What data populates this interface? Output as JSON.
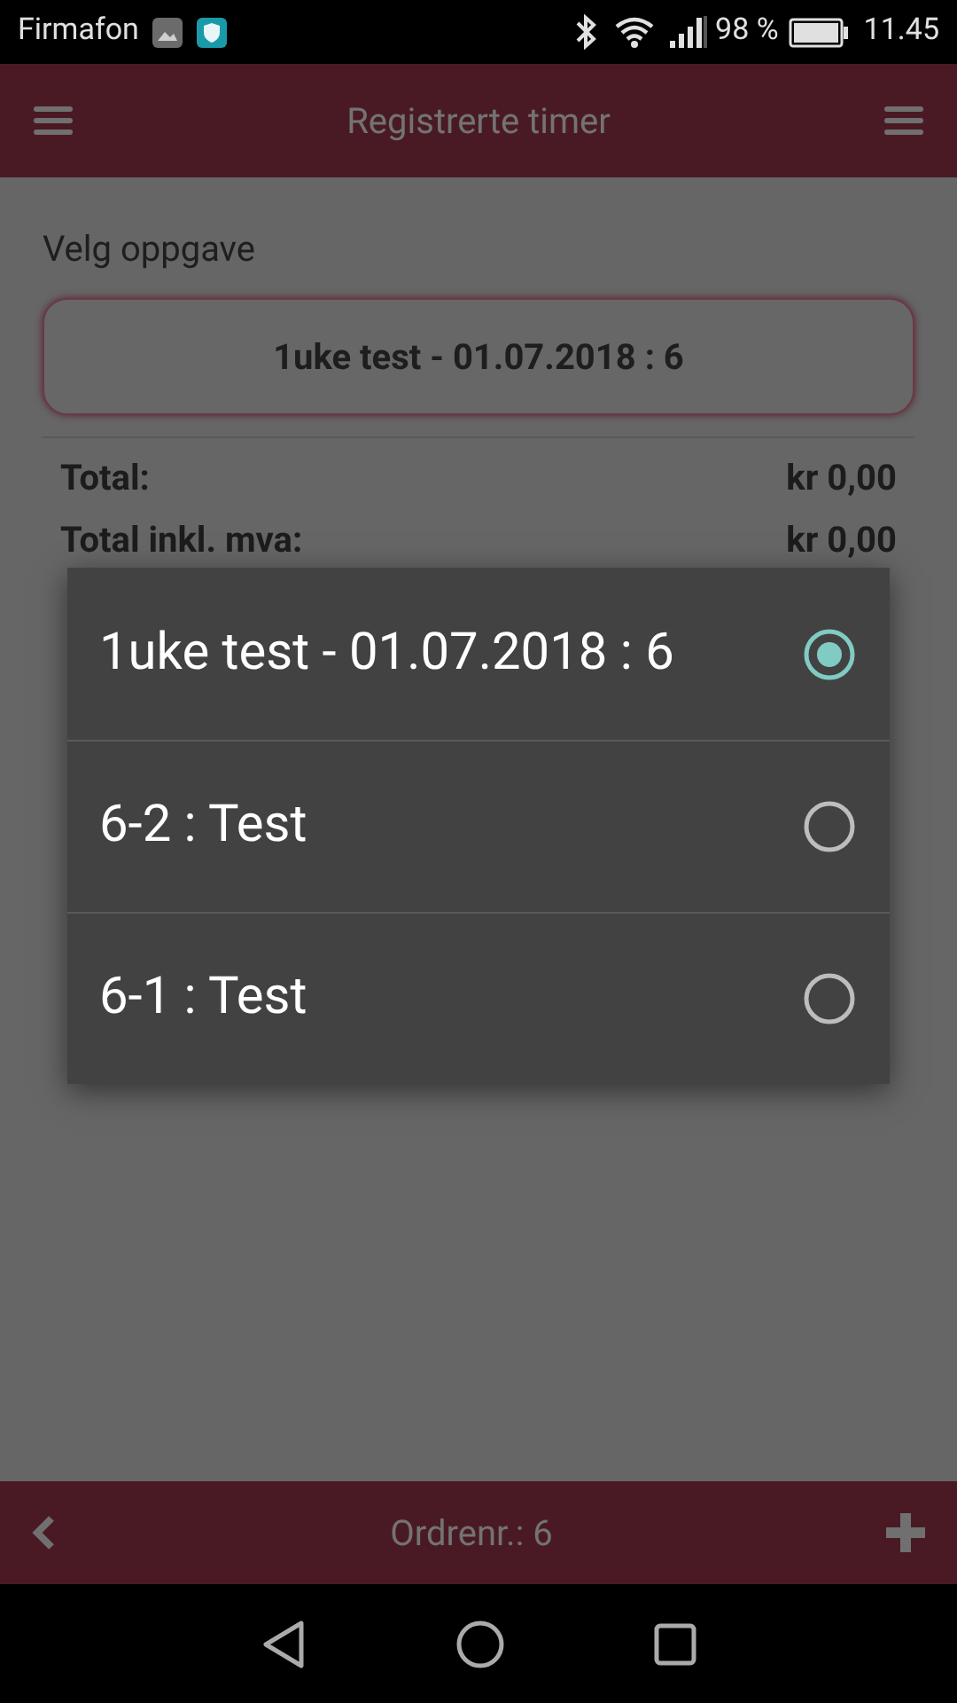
{
  "status_bar": {
    "carrier": "Firmafon",
    "battery": "98 %",
    "time": "11.45"
  },
  "app_bar": {
    "title": "Registrerte timer"
  },
  "form": {
    "label": "Velg oppgave",
    "selected_task": "1uke test - 01.07.2018 : 6"
  },
  "totals": [
    {
      "label": "Total:",
      "value": "kr 0,00"
    },
    {
      "label": "Total inkl. mva:",
      "value": "kr 0,00"
    }
  ],
  "dialog": {
    "options": [
      {
        "label": "1uke test - 01.07.2018 : 6",
        "selected": true
      },
      {
        "label": "6-2 : Test",
        "selected": false
      },
      {
        "label": "6-1 : Test",
        "selected": false
      }
    ]
  },
  "bottom_bar": {
    "title": "Ordrenr.: 6"
  }
}
